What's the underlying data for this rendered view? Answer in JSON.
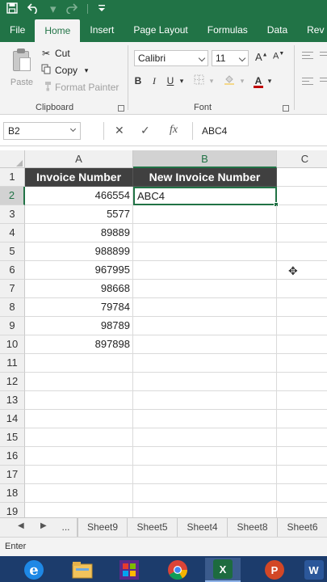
{
  "colors": {
    "brand": "#217346",
    "header_fill": "#404040",
    "taskbar": "#1c3c6c"
  },
  "quick_access": {
    "icons": [
      "save-icon",
      "undo-icon",
      "redo-icon",
      "customize-icon"
    ]
  },
  "tabs": [
    {
      "label": "File",
      "active": false
    },
    {
      "label": "Home",
      "active": true
    },
    {
      "label": "Insert",
      "active": false
    },
    {
      "label": "Page Layout",
      "active": false
    },
    {
      "label": "Formulas",
      "active": false
    },
    {
      "label": "Data",
      "active": false
    },
    {
      "label": "Rev",
      "active": false
    }
  ],
  "clipboard": {
    "paste_label": "Paste",
    "cut_label": "Cut",
    "copy_label": "Copy",
    "format_painter_label": "Format Painter",
    "group_label": "Clipboard"
  },
  "font": {
    "name": "Calibri",
    "size": "11",
    "bold_label": "B",
    "italic_label": "I",
    "underline_label": "U",
    "grow_label": "A",
    "shrink_label": "A",
    "color_label": "A",
    "group_label": "Font"
  },
  "formula_bar": {
    "name_box": "B2",
    "cancel_glyph": "✕",
    "enter_glyph": "✓",
    "fx_label": "fx",
    "value": "ABC4"
  },
  "grid": {
    "columns": [
      {
        "label": "A",
        "selected": false
      },
      {
        "label": "B",
        "selected": true
      },
      {
        "label": "C",
        "selected": false
      }
    ],
    "rows": [
      {
        "num": "1",
        "a": "Invoice Number",
        "b": "New Invoice Number"
      },
      {
        "num": "2",
        "a": "466554",
        "b": "ABC4"
      },
      {
        "num": "3",
        "a": "5577",
        "b": ""
      },
      {
        "num": "4",
        "a": "89889",
        "b": ""
      },
      {
        "num": "5",
        "a": "988899",
        "b": ""
      },
      {
        "num": "6",
        "a": "967995",
        "b": ""
      },
      {
        "num": "7",
        "a": "98668",
        "b": ""
      },
      {
        "num": "8",
        "a": "79784",
        "b": ""
      },
      {
        "num": "9",
        "a": "98789",
        "b": ""
      },
      {
        "num": "10",
        "a": "897898",
        "b": ""
      },
      {
        "num": "11",
        "a": "",
        "b": ""
      },
      {
        "num": "12",
        "a": "",
        "b": ""
      },
      {
        "num": "13",
        "a": "",
        "b": ""
      },
      {
        "num": "14",
        "a": "",
        "b": ""
      },
      {
        "num": "15",
        "a": "",
        "b": ""
      },
      {
        "num": "16",
        "a": "",
        "b": ""
      },
      {
        "num": "17",
        "a": "",
        "b": ""
      },
      {
        "num": "18",
        "a": "",
        "b": ""
      },
      {
        "num": "19",
        "a": "",
        "b": ""
      }
    ]
  },
  "sheets": {
    "ellipsis": "...",
    "tabs": [
      "Sheet9",
      "Sheet5",
      "Sheet4",
      "Sheet8",
      "Sheet6"
    ]
  },
  "status": {
    "mode": "Enter"
  },
  "taskbar": {
    "apps": [
      "ie-icon",
      "explorer-icon",
      "store-icon",
      "chrome-icon",
      "excel-icon",
      "powerpoint-icon",
      "word-icon"
    ],
    "excel_letter": "X",
    "powerpoint_letter": "P",
    "word_letter": "W",
    "ie_letter": "e"
  }
}
